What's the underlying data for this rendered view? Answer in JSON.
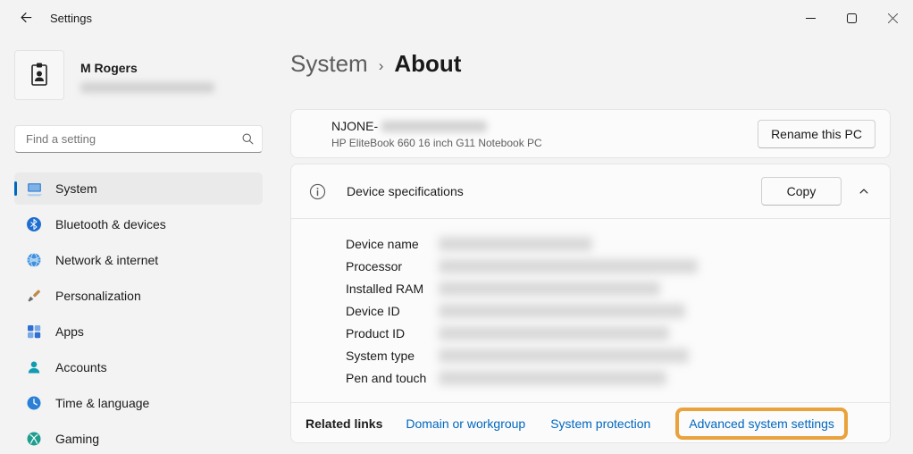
{
  "window": {
    "title": "Settings"
  },
  "sidebar": {
    "user": {
      "name": "M Rogers"
    },
    "search": {
      "placeholder": "Find a setting"
    },
    "items": [
      {
        "label": "System",
        "selected": true
      },
      {
        "label": "Bluetooth & devices",
        "selected": false
      },
      {
        "label": "Network & internet",
        "selected": false
      },
      {
        "label": "Personalization",
        "selected": false
      },
      {
        "label": "Apps",
        "selected": false
      },
      {
        "label": "Accounts",
        "selected": false
      },
      {
        "label": "Time & language",
        "selected": false
      },
      {
        "label": "Gaming",
        "selected": false
      }
    ]
  },
  "main": {
    "breadcrumb": {
      "parent": "System",
      "separator": "›",
      "current": "About"
    },
    "pc_card": {
      "name": "NJONE-",
      "model": "HP EliteBook 660 16 inch G11 Notebook PC",
      "rename_button": "Rename this PC"
    },
    "device_specs": {
      "title": "Device specifications",
      "copy_button": "Copy",
      "rows": [
        "Device name",
        "Processor",
        "Installed RAM",
        "Device ID",
        "Product ID",
        "System type",
        "Pen and touch"
      ]
    },
    "related": {
      "label": "Related links",
      "links": [
        "Domain or workgroup",
        "System protection",
        "Advanced system settings"
      ],
      "highlight_color": "#E9A23C",
      "link_color": "#0067C0"
    }
  }
}
